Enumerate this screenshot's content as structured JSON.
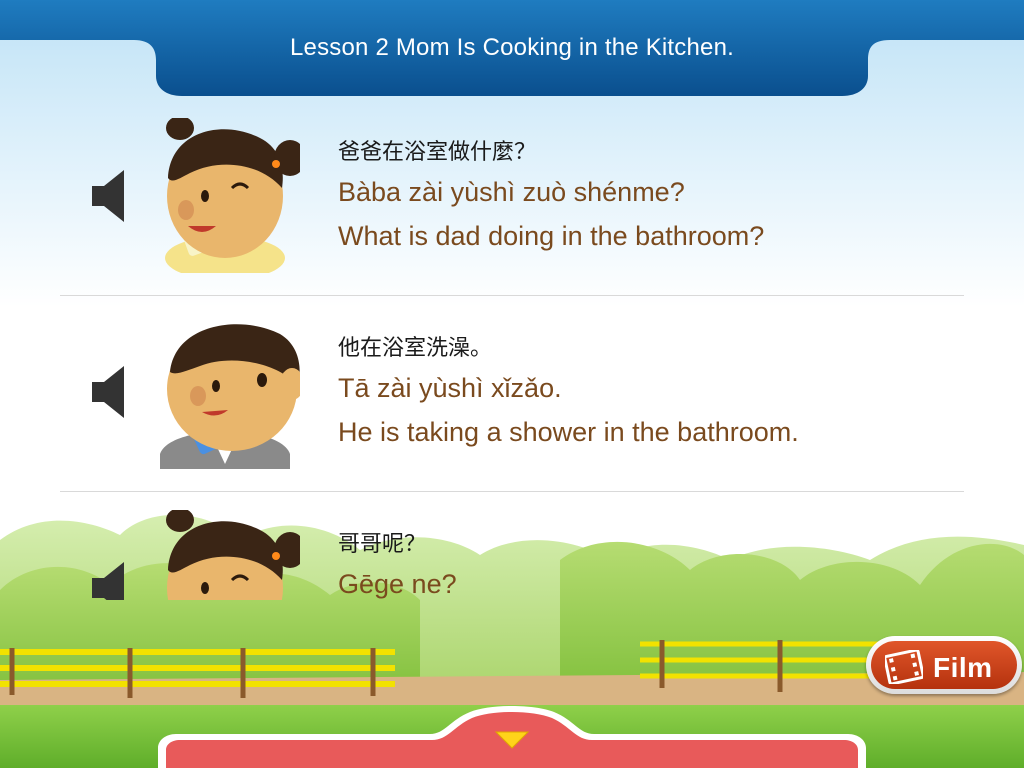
{
  "header": {
    "title": "Lesson 2   Mom Is Cooking in the Kitchen."
  },
  "dialog": [
    {
      "speaker": "girl",
      "hanzi": "爸爸在浴室做什麼？",
      "pinyin": "Bàba zài yùshì zuò shénme?",
      "english": "What is dad doing in the bathroom?"
    },
    {
      "speaker": "boy",
      "hanzi": "他在浴室洗澡。",
      "pinyin": "Tā zài yùshì xǐzǎo.",
      "english": "He is taking a shower in the bathroom."
    },
    {
      "speaker": "girl",
      "hanzi": "哥哥呢？",
      "pinyin": "Gēge ne?"
    }
  ],
  "film_button": {
    "label": "Film",
    "icon": "film-strip-icon"
  },
  "expand_icon": "chevron-down-icon",
  "colors": {
    "header_blue": "#0a5fa5",
    "text_brown": "#7a4a1e",
    "film_orange": "#d2461c",
    "tray_red": "#e85a5a",
    "chevron_yellow": "#ffd31a"
  }
}
